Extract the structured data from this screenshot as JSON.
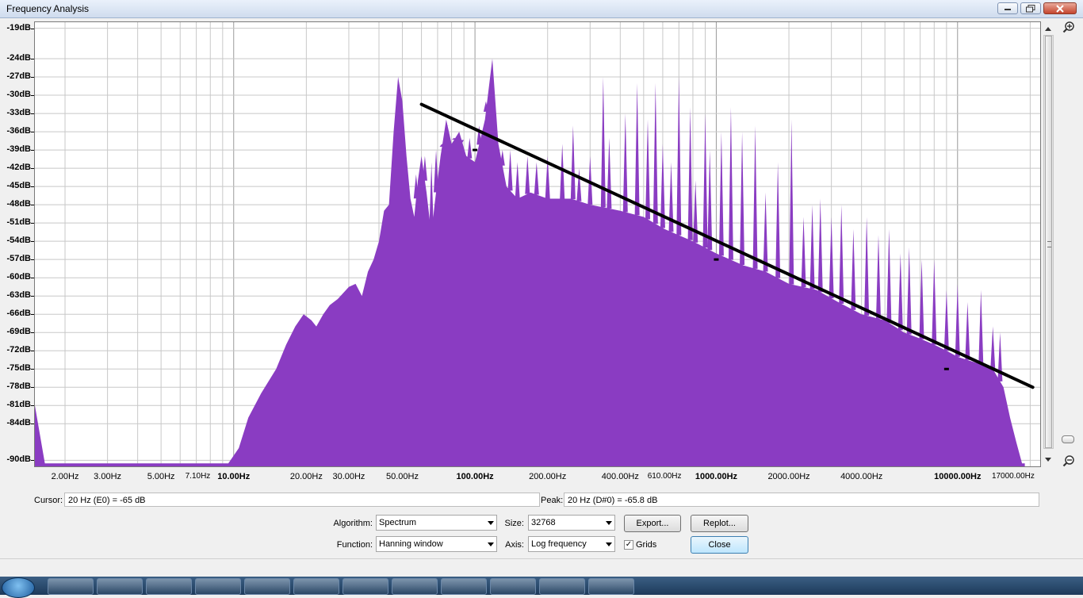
{
  "window": {
    "title": "Frequency Analysis"
  },
  "chart_data": {
    "type": "area",
    "xscale": "log",
    "xlim": [
      1.5,
      22000
    ],
    "ylim": [
      -91,
      -18
    ],
    "ylabel_ticks": [
      "-19dB",
      "-24dB",
      "-27dB",
      "-30dB",
      "-33dB",
      "-36dB",
      "-39dB",
      "-42dB",
      "-45dB",
      "-48dB",
      "-51dB",
      "-54dB",
      "-57dB",
      "-60dB",
      "-63dB",
      "-66dB",
      "-69dB",
      "-72dB",
      "-75dB",
      "-78dB",
      "-81dB",
      "-84dB",
      "-90dB"
    ],
    "xlabel_ticks": [
      {
        "f": 2,
        "label": "2.00Hz"
      },
      {
        "f": 3,
        "label": "3.00Hz"
      },
      {
        "f": 5,
        "label": "5.00Hz"
      },
      {
        "f": 7.1,
        "label": "7.10Hz"
      },
      {
        "f": 10,
        "label": "10.00Hz"
      },
      {
        "f": 20,
        "label": "20.00Hz"
      },
      {
        "f": 30,
        "label": "30.00Hz"
      },
      {
        "f": 50,
        "label": "50.00Hz"
      },
      {
        "f": 100,
        "label": "100.00Hz"
      },
      {
        "f": 200,
        "label": "200.00Hz"
      },
      {
        "f": 400,
        "label": "400.00Hz"
      },
      {
        "f": 610,
        "label": "610.00Hz"
      },
      {
        "f": 1000,
        "label": "1000.00Hz"
      },
      {
        "f": 2000,
        "label": "2000.00Hz"
      },
      {
        "f": 4000,
        "label": "4000.00Hz"
      },
      {
        "f": 10000,
        "label": "10000.00Hz"
      },
      {
        "f": 17000,
        "label": "17000.00Hz"
      }
    ],
    "spectrum_color": "#8a3cc2",
    "envelope": [
      [
        1.5,
        -81
      ],
      [
        1.65,
        -90.5
      ],
      [
        9.5,
        -90.5
      ],
      [
        10.5,
        -88
      ],
      [
        11.5,
        -83
      ],
      [
        13,
        -79
      ],
      [
        15,
        -75
      ],
      [
        16.5,
        -71
      ],
      [
        18,
        -68
      ],
      [
        19.5,
        -66
      ],
      [
        21,
        -67
      ],
      [
        22,
        -68
      ],
      [
        23.5,
        -66
      ],
      [
        25,
        -64.5
      ],
      [
        27,
        -63.5
      ],
      [
        30,
        -61.5
      ],
      [
        32,
        -61
      ],
      [
        34,
        -63
      ],
      [
        36,
        -59
      ],
      [
        38,
        -57
      ],
      [
        40,
        -54
      ],
      [
        42,
        -49
      ],
      [
        44,
        -48
      ],
      [
        46,
        -36
      ],
      [
        48,
        -27
      ],
      [
        50,
        -31
      ],
      [
        52,
        -40
      ],
      [
        54,
        -47
      ],
      [
        56,
        -50
      ],
      [
        58,
        -44
      ],
      [
        60,
        -40
      ],
      [
        63,
        -46
      ],
      [
        66,
        -53
      ],
      [
        68,
        -48
      ],
      [
        72,
        -40
      ],
      [
        76,
        -34
      ],
      [
        80,
        -38
      ],
      [
        86,
        -36
      ],
      [
        92,
        -40
      ],
      [
        100,
        -41
      ],
      [
        110,
        -34
      ],
      [
        118,
        -24
      ],
      [
        125,
        -38
      ],
      [
        135,
        -45
      ],
      [
        150,
        -47
      ],
      [
        170,
        -46
      ],
      [
        200,
        -47
      ],
      [
        250,
        -47
      ],
      [
        300,
        -48
      ],
      [
        400,
        -49
      ],
      [
        500,
        -50
      ],
      [
        610,
        -52
      ],
      [
        800,
        -54
      ],
      [
        1000,
        -56
      ],
      [
        1300,
        -58
      ],
      [
        1600,
        -59
      ],
      [
        2000,
        -61
      ],
      [
        2600,
        -62
      ],
      [
        3200,
        -64
      ],
      [
        4000,
        -66
      ],
      [
        5000,
        -67
      ],
      [
        6000,
        -69
      ],
      [
        7000,
        -70
      ],
      [
        8000,
        -71
      ],
      [
        9000,
        -72
      ],
      [
        10000,
        -73
      ],
      [
        12000,
        -74
      ],
      [
        14000,
        -75
      ],
      [
        15500,
        -78
      ],
      [
        16500,
        -83
      ],
      [
        17500,
        -87
      ],
      [
        18500,
        -90.5
      ],
      [
        19000,
        -90.5
      ]
    ],
    "spikes": [
      [
        118,
        -24
      ],
      [
        111,
        -31
      ],
      [
        104,
        -35
      ],
      [
        95,
        -37
      ],
      [
        88,
        -38
      ],
      [
        82,
        -37
      ],
      [
        77,
        -35
      ],
      [
        73,
        -38
      ],
      [
        69,
        -39
      ],
      [
        66,
        -41
      ],
      [
        62,
        -40
      ],
      [
        57,
        -43
      ],
      [
        130,
        -39
      ],
      [
        140,
        -39
      ],
      [
        150,
        -41
      ],
      [
        165,
        -40
      ],
      [
        180,
        -41
      ],
      [
        200,
        -40
      ],
      [
        230,
        -38
      ],
      [
        255,
        -35
      ],
      [
        270,
        -42
      ],
      [
        300,
        -40
      ],
      [
        340,
        -27
      ],
      [
        360,
        -37
      ],
      [
        420,
        -33
      ],
      [
        470,
        -28
      ],
      [
        520,
        -34
      ],
      [
        560,
        -28
      ],
      [
        600,
        -38
      ],
      [
        650,
        -41
      ],
      [
        700,
        -27
      ],
      [
        780,
        -32
      ],
      [
        820,
        -44
      ],
      [
        900,
        -33
      ],
      [
        940,
        -39
      ],
      [
        1050,
        -36
      ],
      [
        1150,
        -32
      ],
      [
        1280,
        -36
      ],
      [
        1450,
        -35
      ],
      [
        1600,
        -46
      ],
      [
        1800,
        -41
      ],
      [
        2050,
        -34
      ],
      [
        2300,
        -50
      ],
      [
        2500,
        -48
      ],
      [
        2700,
        -47
      ],
      [
        3000,
        -50
      ],
      [
        3300,
        -48
      ],
      [
        3700,
        -52
      ],
      [
        4200,
        -50
      ],
      [
        4700,
        -53
      ],
      [
        5200,
        -52
      ],
      [
        5800,
        -56
      ],
      [
        6300,
        -55
      ],
      [
        7100,
        -57
      ],
      [
        8000,
        -57
      ],
      [
        9000,
        -62
      ],
      [
        10000,
        -61
      ],
      [
        11000,
        -64
      ],
      [
        12500,
        -62
      ],
      [
        14000,
        -68
      ],
      [
        15000,
        -69
      ]
    ],
    "overlay_line": {
      "from": [
        60,
        -31.5
      ],
      "to": [
        20500,
        -78
      ],
      "color": "#000000"
    },
    "markers": [
      [
        100,
        -39
      ],
      [
        1000,
        -57
      ],
      [
        9000,
        -75
      ]
    ]
  },
  "readouts": {
    "cursor_label": "Cursor:",
    "cursor_value": "20 Hz (E0) = -65 dB",
    "peak_label": "Peak:",
    "peak_value": "20 Hz (D#0) = -65.8 dB"
  },
  "controls": {
    "algorithm_label": "Algorithm:",
    "algorithm_value": "Spectrum",
    "size_label": "Size:",
    "size_value": "32768",
    "function_label": "Function:",
    "function_value": "Hanning window",
    "axis_label": "Axis:",
    "axis_value": "Log frequency",
    "grids_label": "Grids",
    "grids_checked": true,
    "export_label": "Export...",
    "replot_label": "Replot...",
    "close_label": "Close"
  }
}
